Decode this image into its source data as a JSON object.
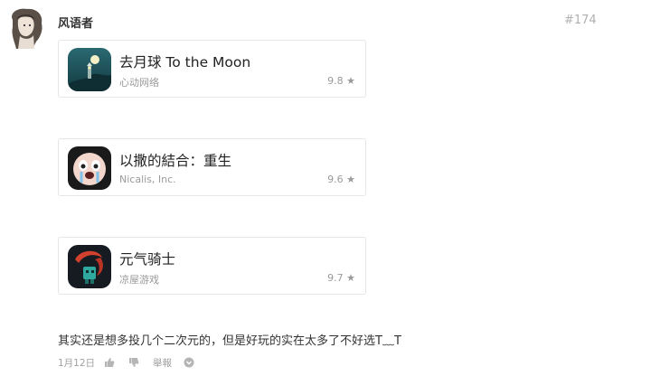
{
  "post": {
    "username": "风语者",
    "number": "#174",
    "comment": "其实还是想多投几个二次元的，但是好玩的实在太多了不好选T﹏T",
    "date": "1月12日",
    "report_label": "舉報"
  },
  "apps": [
    {
      "name": "去月球 To the Moon",
      "developer": "心动网络",
      "rating": "9.8 ★",
      "icon": "to-the-moon-icon"
    },
    {
      "name": "以撒的結合：重生",
      "developer": "Nicalis, Inc.",
      "rating": "9.6 ★",
      "icon": "binding-of-isaac-icon"
    },
    {
      "name": "元气骑士",
      "developer": "凉屋游戏",
      "rating": "9.7 ★",
      "icon": "soul-knight-icon"
    }
  ],
  "icons": {
    "like": "thumbs-up-icon",
    "dislike": "thumbs-down-icon",
    "more": "more-icon"
  },
  "colors": {
    "text": "#333333",
    "muted": "#9a9a9a",
    "card_border": "#e6e6e6"
  }
}
